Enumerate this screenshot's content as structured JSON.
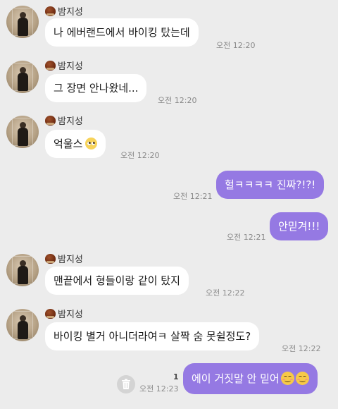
{
  "sender_name": "밤지성",
  "messages": {
    "m1": {
      "text": "나 에버랜드에서 바이킹 탔는데",
      "time": "오전 12:20"
    },
    "m2": {
      "text": "그 장면 안나왔네...",
      "time": "오전 12:20"
    },
    "m3": {
      "text": "억울스",
      "emoji": "pleading-face-icon",
      "time": "오전 12:20"
    },
    "m4": {
      "text": "헐ㅋㅋㅋㅋ 진짜?!?!",
      "time": "오전 12:21"
    },
    "m5": {
      "text": "안믿겨!!!",
      "time": "오전 12:21"
    },
    "m6": {
      "text": "맨끝에서 형들이랑 같이 탔지",
      "time": "오전 12:22"
    },
    "m7": {
      "text": "바이킹 별거 아니더라여ㅋ 살짝 숨 못쉴정도?",
      "time": "오전 12:22"
    },
    "m8": {
      "text": "에이 거짓말 안 믿어",
      "emoji": "smiling-face-icon",
      "time": "오전 12:23",
      "unread": "1"
    }
  },
  "colors": {
    "background": "#ececec",
    "incoming_bubble": "#ffffff",
    "outgoing_bubble": "#9579e3",
    "timestamp": "#8a8a8a"
  }
}
